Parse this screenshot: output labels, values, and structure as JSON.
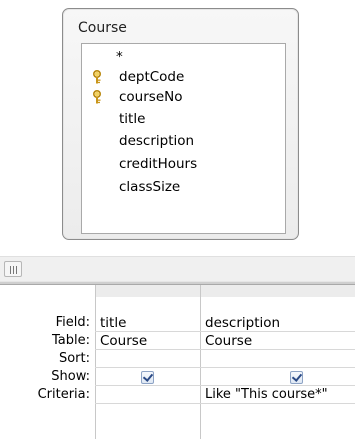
{
  "design_pane": {
    "table": {
      "title": "Course",
      "fields": [
        {
          "name": "*",
          "primary_key": false,
          "icon": ""
        },
        {
          "name": "deptCode",
          "primary_key": true,
          "icon": "primary-key-icon"
        },
        {
          "name": "courseNo",
          "primary_key": true,
          "icon": "primary-key-icon"
        },
        {
          "name": "title",
          "primary_key": false,
          "icon": ""
        },
        {
          "name": "description",
          "primary_key": false,
          "icon": ""
        },
        {
          "name": "creditHours",
          "primary_key": false,
          "icon": ""
        },
        {
          "name": "classSize",
          "primary_key": false,
          "icon": ""
        }
      ]
    }
  },
  "grid": {
    "row_labels": {
      "field": "Field:",
      "table": "Table:",
      "sort": "Sort:",
      "show": "Show:",
      "criteria": "Criteria:"
    },
    "columns": [
      {
        "field": "title",
        "table": "Course",
        "sort": "",
        "show": true,
        "criteria": ""
      },
      {
        "field": "description",
        "table": "Course",
        "sort": "",
        "show": true,
        "criteria": "Like \"This course*\""
      }
    ]
  },
  "colors": {
    "key_icon": "#d4a017",
    "checkbox_check": "#2b4a86",
    "table_border": "#8c8c8c"
  }
}
